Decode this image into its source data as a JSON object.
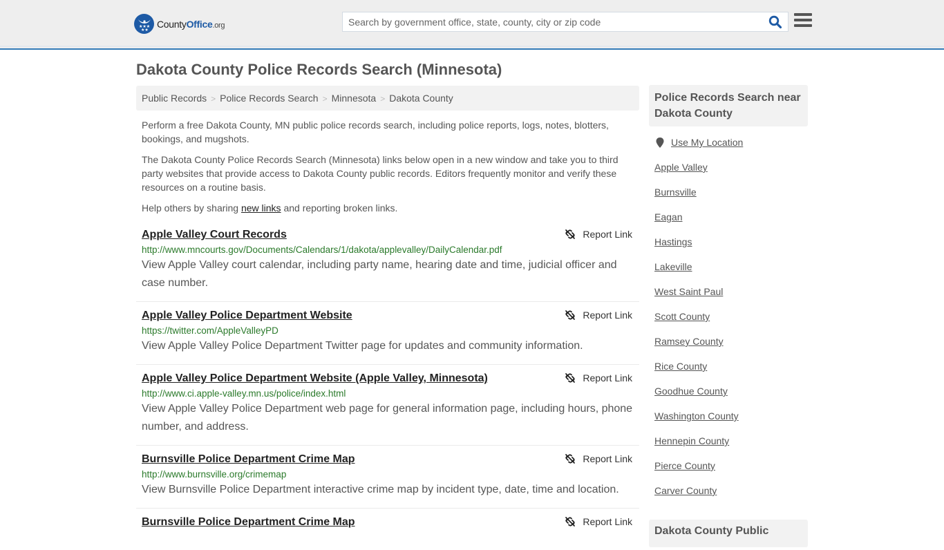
{
  "header": {
    "logo": {
      "county": "County",
      "office": "Office",
      "org": ".org"
    },
    "search": {
      "placeholder": "Search by government office, state, county, city or zip code",
      "value": ""
    },
    "accent_color": "#337ab7"
  },
  "page": {
    "title": "Dakota County Police Records Search (Minnesota)"
  },
  "breadcrumb": [
    {
      "label": "Public Records"
    },
    {
      "label": "Police Records Search"
    },
    {
      "label": "Minnesota"
    },
    {
      "label": "Dakota County"
    }
  ],
  "breadcrumb_separator": ">",
  "intro": {
    "p1": "Perform a free Dakota County, MN public police records search, including police reports, logs, notes, blotters, bookings, and mugshots.",
    "p2": "The Dakota County Police Records Search (Minnesota) links below open in a new window and take you to third party websites that provide access to Dakota County public records. Editors frequently monitor and verify these resources on a routine basis.",
    "p3_before": "Help others by sharing ",
    "p3_link": "new links",
    "p3_after": " and reporting broken links."
  },
  "report_label": "Report Link",
  "results": [
    {
      "title": "Apple Valley Court Records",
      "url": "http://www.mncourts.gov/Documents/Calendars/1/dakota/applevalley/DailyCalendar.pdf",
      "desc": "View Apple Valley court calendar, including party name, hearing date and time, judicial officer and case number."
    },
    {
      "title": "Apple Valley Police Department Website",
      "url": "https://twitter.com/AppleValleyPD",
      "desc": "View Apple Valley Police Department Twitter page for updates and community information."
    },
    {
      "title": "Apple Valley Police Department Website (Apple Valley, Minnesota)",
      "url": "http://www.ci.apple-valley.mn.us/police/index.html",
      "desc": "View Apple Valley Police Department web page for general information page, including hours, phone number, and address."
    },
    {
      "title": "Burnsville Police Department Crime Map",
      "url": "http://www.burnsville.org/crimemap",
      "desc": "View Burnsville Police Department interactive crime map by incident type, date, time and location."
    },
    {
      "title": "Burnsville Police Department Crime Map",
      "url": "",
      "desc": ""
    }
  ],
  "sidebar": {
    "heading": "Police Records Search near Dakota County",
    "use_location": "Use My Location",
    "items": [
      "Apple Valley",
      "Burnsville",
      "Eagan",
      "Hastings",
      "Lakeville",
      "West Saint Paul",
      "Scott County",
      "Ramsey County",
      "Rice County",
      "Goodhue County",
      "Washington County",
      "Hennepin County",
      "Pierce County",
      "Carver County"
    ],
    "heading2": "Dakota County Public"
  }
}
